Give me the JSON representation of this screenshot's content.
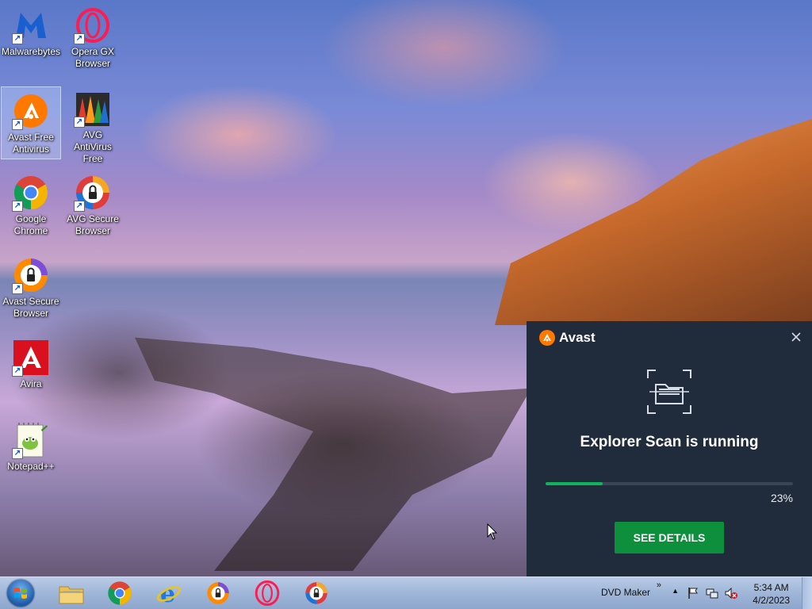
{
  "desktop": {
    "icons": [
      {
        "label": "Malwarebytes",
        "icon": "malwarebytes-icon"
      },
      {
        "label": "Opera GX Browser",
        "icon": "opera-gx-icon"
      },
      {
        "label": "Avast Free Antivirus",
        "icon": "avast-icon"
      },
      {
        "label": "AVG AntiVirus Free",
        "icon": "avg-icon"
      },
      {
        "label": "Google Chrome",
        "icon": "chrome-icon"
      },
      {
        "label": "AVG Secure Browser",
        "icon": "avg-secure-browser-icon"
      },
      {
        "label": "Avast Secure Browser",
        "icon": "avast-secure-browser-icon"
      },
      {
        "label": "Avira",
        "icon": "avira-icon"
      },
      {
        "label": "Notepad++",
        "icon": "notepad-plus-plus-icon"
      }
    ]
  },
  "popup": {
    "brand": "Avast",
    "title": "Explorer Scan is running",
    "progress_percent": 23,
    "progress_label": "23%",
    "button_label": "SEE DETAILS",
    "colors": {
      "background": "#202c3c",
      "progress": "#12b25a",
      "button": "#0e8f3c",
      "brand": "#ff7800"
    }
  },
  "taskbar": {
    "items": [
      "Windows Explorer",
      "Google Chrome",
      "Internet Explorer",
      "Avast Secure Browser",
      "Opera GX Browser",
      "AVG Secure Browser"
    ],
    "toolbar_label": "DVD Maker",
    "time": "5:34 AM",
    "date": "4/2/2023"
  }
}
